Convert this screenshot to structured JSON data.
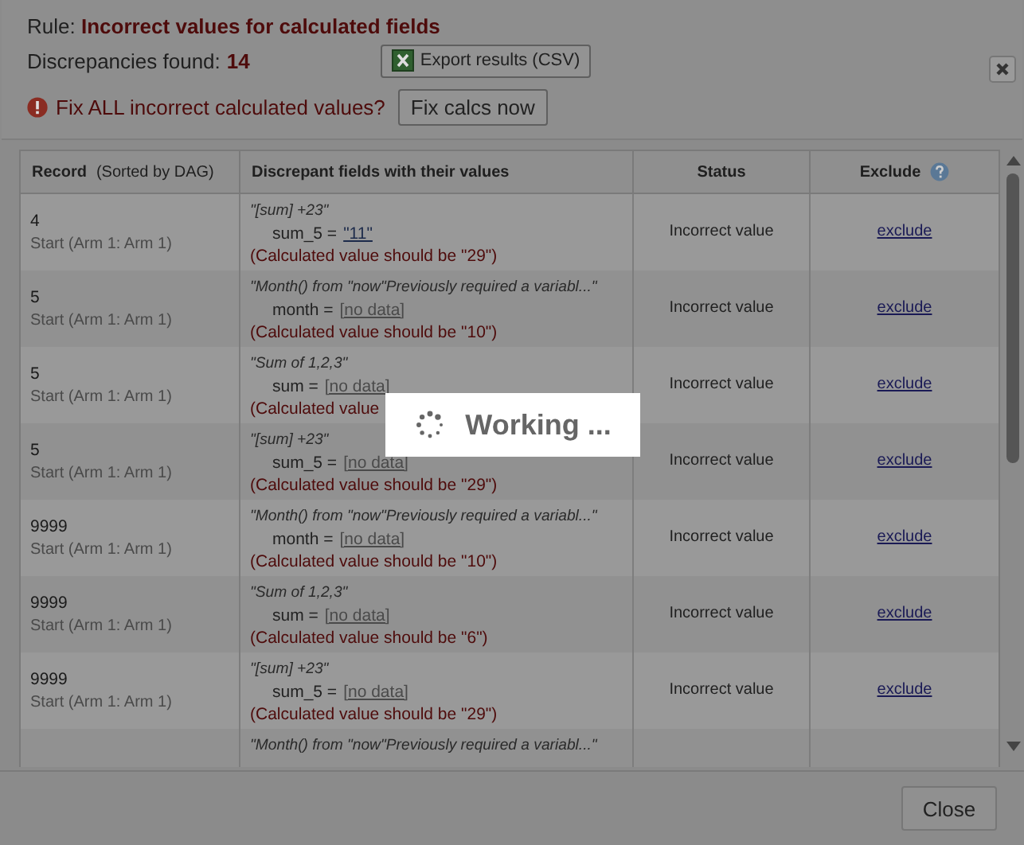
{
  "dialog": {
    "rule_label": "Rule:",
    "rule_name": "Incorrect values for calculated fields",
    "discrepancies_label": "Discrepancies found:",
    "discrepancies_count": "14",
    "export_button": "Export results (CSV)",
    "fix_prompt": "Fix ALL incorrect calculated values?",
    "fix_button": "Fix calcs now"
  },
  "table": {
    "columns": [
      {
        "label": "Record",
        "note": "(Sorted by DAG)"
      },
      {
        "label": "Discrepant fields with their values"
      },
      {
        "label": "Status"
      },
      {
        "label": "Exclude",
        "help": true
      }
    ],
    "rows": [
      {
        "record": "4",
        "event": "Start (Arm 1: Arm 1)",
        "formula": "\"[sum] +23\"",
        "field": "sum_5 =",
        "kind": "value",
        "value": "\"11\"",
        "note": "(Calculated value should be \"29\")",
        "status": "Incorrect value",
        "action": "exclude"
      },
      {
        "record": "5",
        "event": "Start (Arm 1: Arm 1)",
        "formula": "\"Month() from \"now\"Previously required a variabl...\"",
        "field": "month =",
        "kind": "empty",
        "value": "[no data]",
        "note": "(Calculated value should be \"10\")",
        "status": "Incorrect value",
        "action": "exclude"
      },
      {
        "record": "5",
        "event": "Start (Arm 1: Arm 1)",
        "formula": "\"Sum of 1,2,3\"",
        "field": "sum =",
        "kind": "empty",
        "value": "[no data]",
        "note": "(Calculated value",
        "status": "Incorrect value",
        "action": "exclude"
      },
      {
        "record": "5",
        "event": "Start (Arm 1: Arm 1)",
        "formula": "\"[sum] +23\"",
        "field": "sum_5 =",
        "kind": "empty",
        "value": "[no data]",
        "note": "(Calculated value should be \"29\")",
        "status": "Incorrect value",
        "action": "exclude"
      },
      {
        "record": "9999",
        "event": "Start (Arm 1: Arm 1)",
        "formula": "\"Month() from \"now\"Previously required a variabl...\"",
        "field": "month =",
        "kind": "empty",
        "value": "[no data]",
        "note": "(Calculated value should be \"10\")",
        "status": "Incorrect value",
        "action": "exclude"
      },
      {
        "record": "9999",
        "event": "Start (Arm 1: Arm 1)",
        "formula": "\"Sum of 1,2,3\"",
        "field": "sum =",
        "kind": "empty",
        "value": "[no data]",
        "note": "(Calculated value should be \"6\")",
        "status": "Incorrect value",
        "action": "exclude"
      },
      {
        "record": "9999",
        "event": "Start (Arm 1: Arm 1)",
        "formula": "\"[sum] +23\"",
        "field": "sum_5 =",
        "kind": "empty",
        "value": "[no data]",
        "note": "(Calculated value should be \"29\")",
        "status": "Incorrect value",
        "action": "exclude"
      },
      {
        "formula": "\"Month() from \"now\"Previously required a variabl...\""
      }
    ]
  },
  "footer": {
    "close_button": "Close"
  },
  "busy_overlay": {
    "message": "Working ..."
  }
}
